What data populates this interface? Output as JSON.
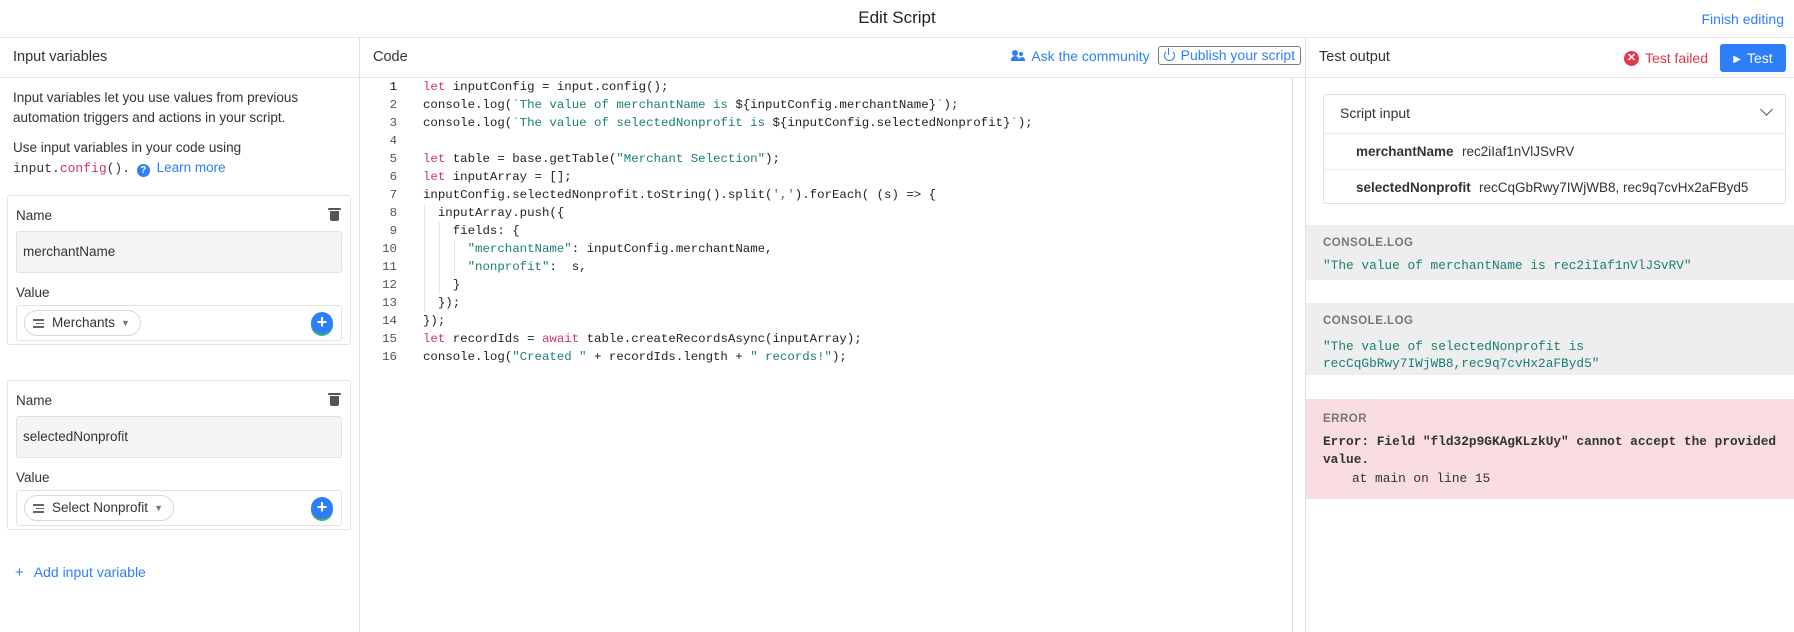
{
  "header": {
    "title": "Edit Script",
    "finish_label": "Finish editing"
  },
  "left": {
    "title": "Input variables",
    "intro1": "Input variables let you use values from previous automation triggers and actions in your script.",
    "intro2_prefix": "Use input variables in your code using",
    "intro2_code_obj": "input.",
    "intro2_code_fn": "config",
    "intro2_code_end": "().",
    "learn_more": "Learn more",
    "variables": [
      {
        "name_label": "Name",
        "name_value": "merchantName",
        "value_label": "Value",
        "value_pill": "Merchants"
      },
      {
        "name_label": "Name",
        "name_value": "selectedNonprofit",
        "value_label": "Value",
        "value_pill": "Select Nonprofit"
      }
    ],
    "add_label": "Add input variable"
  },
  "middle": {
    "title": "Code",
    "ask_label": "Ask the community",
    "publish_label": "Publish your script",
    "active_line": 1,
    "lines": [
      [
        [
          "kw",
          "let"
        ],
        [
          "t",
          " inputConfig = input.config();"
        ]
      ],
      [
        [
          "t",
          "console.log("
        ],
        [
          "str",
          "`The value of merchantName is "
        ],
        [
          "t",
          "${inputConfig.merchantName}"
        ],
        [
          "str",
          "`"
        ],
        [
          "t",
          ");"
        ]
      ],
      [
        [
          "t",
          "console.log("
        ],
        [
          "str",
          "`The value of selectedNonprofit is "
        ],
        [
          "t",
          "${inputConfig.selectedNonprofit}"
        ],
        [
          "str",
          "`"
        ],
        [
          "t",
          ");"
        ]
      ],
      [],
      [
        [
          "kw",
          "let"
        ],
        [
          "t",
          " table = base.getTable("
        ],
        [
          "str",
          "\"Merchant Selection\""
        ],
        [
          "t",
          ");"
        ]
      ],
      [
        [
          "kw",
          "let"
        ],
        [
          "t",
          " inputArray = [];"
        ]
      ],
      [
        [
          "t",
          "inputConfig.selectedNonprofit.toString().split("
        ],
        [
          "str",
          "','"
        ],
        [
          "t",
          ").forEach( (s) => {"
        ]
      ],
      [
        [
          "t",
          "  inputArray.push({"
        ]
      ],
      [
        [
          "t",
          "    fields: {"
        ]
      ],
      [
        [
          "t",
          "      "
        ],
        [
          "str",
          "\"merchantName\""
        ],
        [
          "t",
          ": inputConfig.merchantName,"
        ]
      ],
      [
        [
          "t",
          "      "
        ],
        [
          "str",
          "\"nonprofit\""
        ],
        [
          "t",
          ":  s,"
        ]
      ],
      [
        [
          "t",
          "    }"
        ]
      ],
      [
        [
          "t",
          "  });"
        ]
      ],
      [
        [
          "t",
          "});"
        ]
      ],
      [
        [
          "kw",
          "let"
        ],
        [
          "t",
          " recordIds = "
        ],
        [
          "kw",
          "await"
        ],
        [
          "t",
          " table.createRecordsAsync(inputArray);"
        ]
      ],
      [
        [
          "t",
          "console.log("
        ],
        [
          "str",
          "\"Created \""
        ],
        [
          "t",
          " + recordIds.length + "
        ],
        [
          "str",
          "\" records!\""
        ],
        [
          "t",
          ");"
        ]
      ]
    ]
  },
  "right": {
    "title": "Test output",
    "status": "Test failed",
    "test_label": "Test",
    "script_input": {
      "title": "Script input",
      "rows": [
        {
          "key": "merchantName",
          "value": "rec2iIaf1nVlJSvRV"
        },
        {
          "key": "selectedNonprofit",
          "value": "recCqGbRwy7IWjWB8, rec9q7cvHx2aFByd5"
        }
      ]
    },
    "logs": [
      {
        "label": "CONSOLE.LOG",
        "text": "\"The value of merchantName is rec2iIaf1nVlJSvRV\""
      },
      {
        "label": "CONSOLE.LOG",
        "text": "\"The value of selectedNonprofit is\nrecCqGbRwy7IWjWB8,rec9q7cvHx2aFByd5\""
      }
    ],
    "error": {
      "label": "ERROR",
      "text": "Error: Field \"fld32p9GKAgKLzkUy\" cannot accept the provided value.",
      "sub": "at main on line 15"
    }
  }
}
